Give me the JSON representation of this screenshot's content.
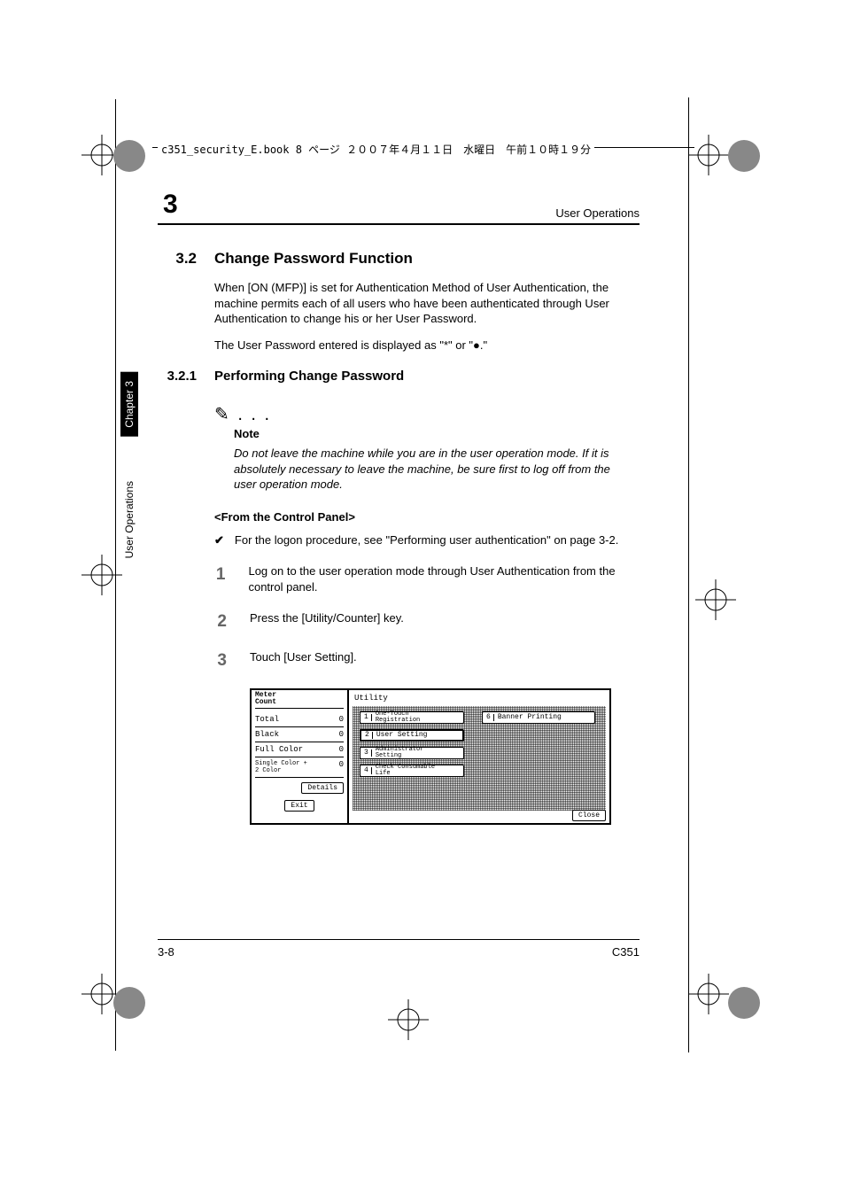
{
  "book_header": "c351_security_E.book  8 ページ  ２００７年４月１１日　水曜日　午前１０時１９分",
  "chapter_number": "3",
  "running_head": "User Operations",
  "side_tab_dark": "Chapter 3",
  "side_tab_light": "User Operations",
  "section": {
    "num": "3.2",
    "title": "Change Password Function",
    "para1": "When [ON (MFP)] is set for Authentication Method of User Authentication, the machine permits each of all users who have been authenticated through User Authentication to change his or her User Password.",
    "para2": "The User Password entered is displayed as \"*\" or \"●.\""
  },
  "subsection": {
    "num": "3.2.1",
    "title": "Performing Change Password"
  },
  "note": {
    "icon": "✎ . . .",
    "label": "Note",
    "body": "Do not leave the machine while you are in the user operation mode. If it is absolutely necessary to leave the machine, be sure first to log off from the user operation mode."
  },
  "from_panel": "<From the Control Panel>",
  "checkmark": "✔",
  "check_text": "For the logon procedure, see \"Performing user authentication\" on page 3-2.",
  "steps": {
    "s1n": "1",
    "s1t": "Log on to the user operation mode through User Authentication from the control panel.",
    "s2n": "2",
    "s2t": "Press the [Utility/Counter] key.",
    "s3n": "3",
    "s3t": "Touch [User Setting]."
  },
  "screen": {
    "meter_title": "Meter\nCount",
    "rows": {
      "total": "Total",
      "total_v": "0",
      "black": "Black",
      "black_v": "0",
      "full": "Full Color",
      "full_v": "0",
      "single": "Single Color +\n2 Color",
      "single_v": "0"
    },
    "details": "Details",
    "exit": "Exit",
    "utility": "Utility",
    "menu": {
      "m1n": "1",
      "m1": "One-Touch\nRegistration",
      "m2n": "2",
      "m2": "User Setting",
      "m3n": "3",
      "m3": "Administrator\nSetting",
      "m4n": "4",
      "m4": "Check Consumable\nLife",
      "m6n": "6",
      "m6": "Banner Printing"
    },
    "close": "Close"
  },
  "footer_left": "3-8",
  "footer_right": "C351"
}
